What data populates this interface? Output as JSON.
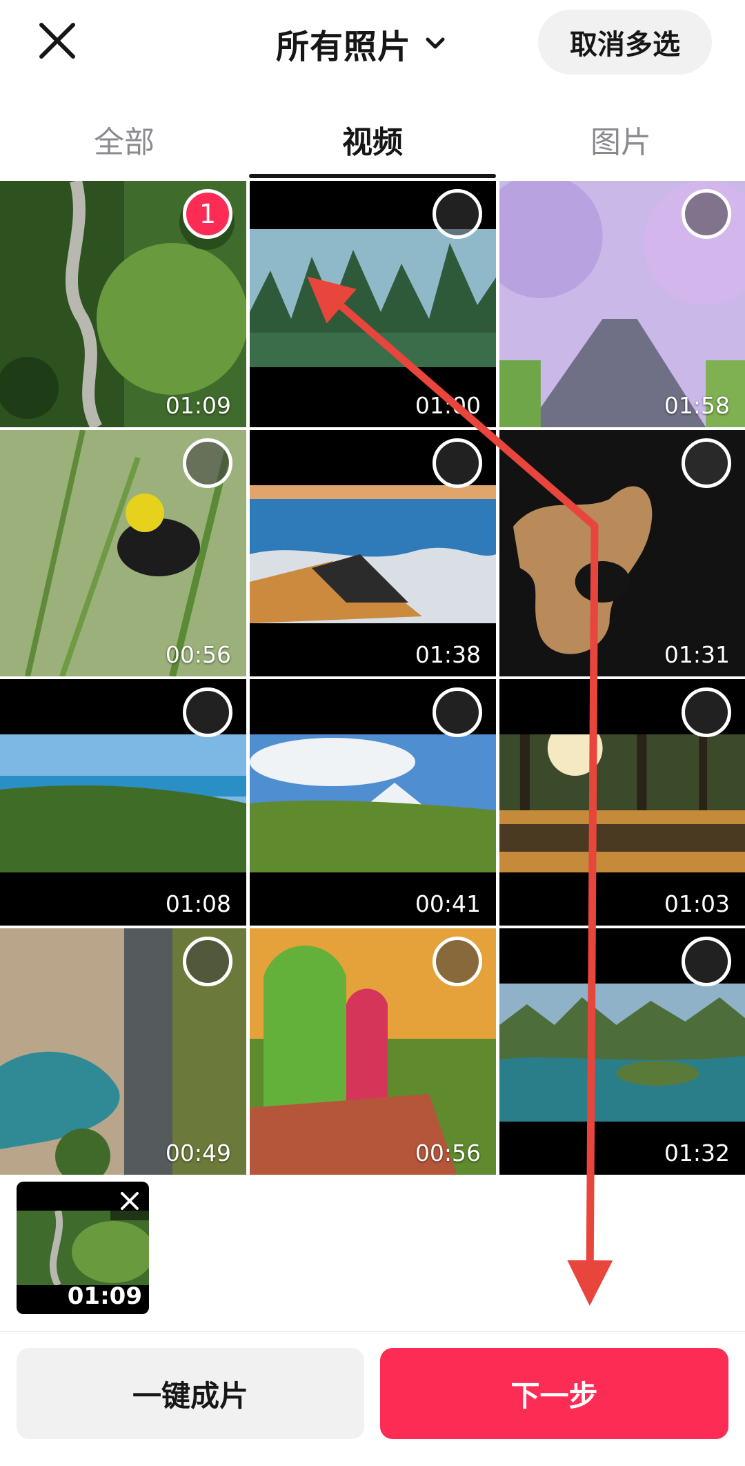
{
  "header": {
    "title": "所有照片",
    "cancel_multi": "取消多选"
  },
  "tabs": [
    "全部",
    "视频",
    "图片"
  ],
  "active_tab_index": 1,
  "grid": [
    {
      "duration": "01:09",
      "selected": true,
      "order": "1"
    },
    {
      "duration": "01:00",
      "selected": false
    },
    {
      "duration": "01:58",
      "selected": false
    },
    {
      "duration": "00:56",
      "selected": false
    },
    {
      "duration": "01:38",
      "selected": false
    },
    {
      "duration": "01:31",
      "selected": false
    },
    {
      "duration": "01:08",
      "selected": false
    },
    {
      "duration": "00:41",
      "selected": false
    },
    {
      "duration": "01:03",
      "selected": false
    },
    {
      "duration": "00:49",
      "selected": false
    },
    {
      "duration": "00:56",
      "selected": false
    },
    {
      "duration": "01:32",
      "selected": false
    }
  ],
  "tray": {
    "duration": "01:09"
  },
  "buttons": {
    "auto_edit": "一键成片",
    "next": "下一步"
  },
  "colors": {
    "accent": "#fc2c55",
    "annotation_arrow": "#e8453c"
  }
}
